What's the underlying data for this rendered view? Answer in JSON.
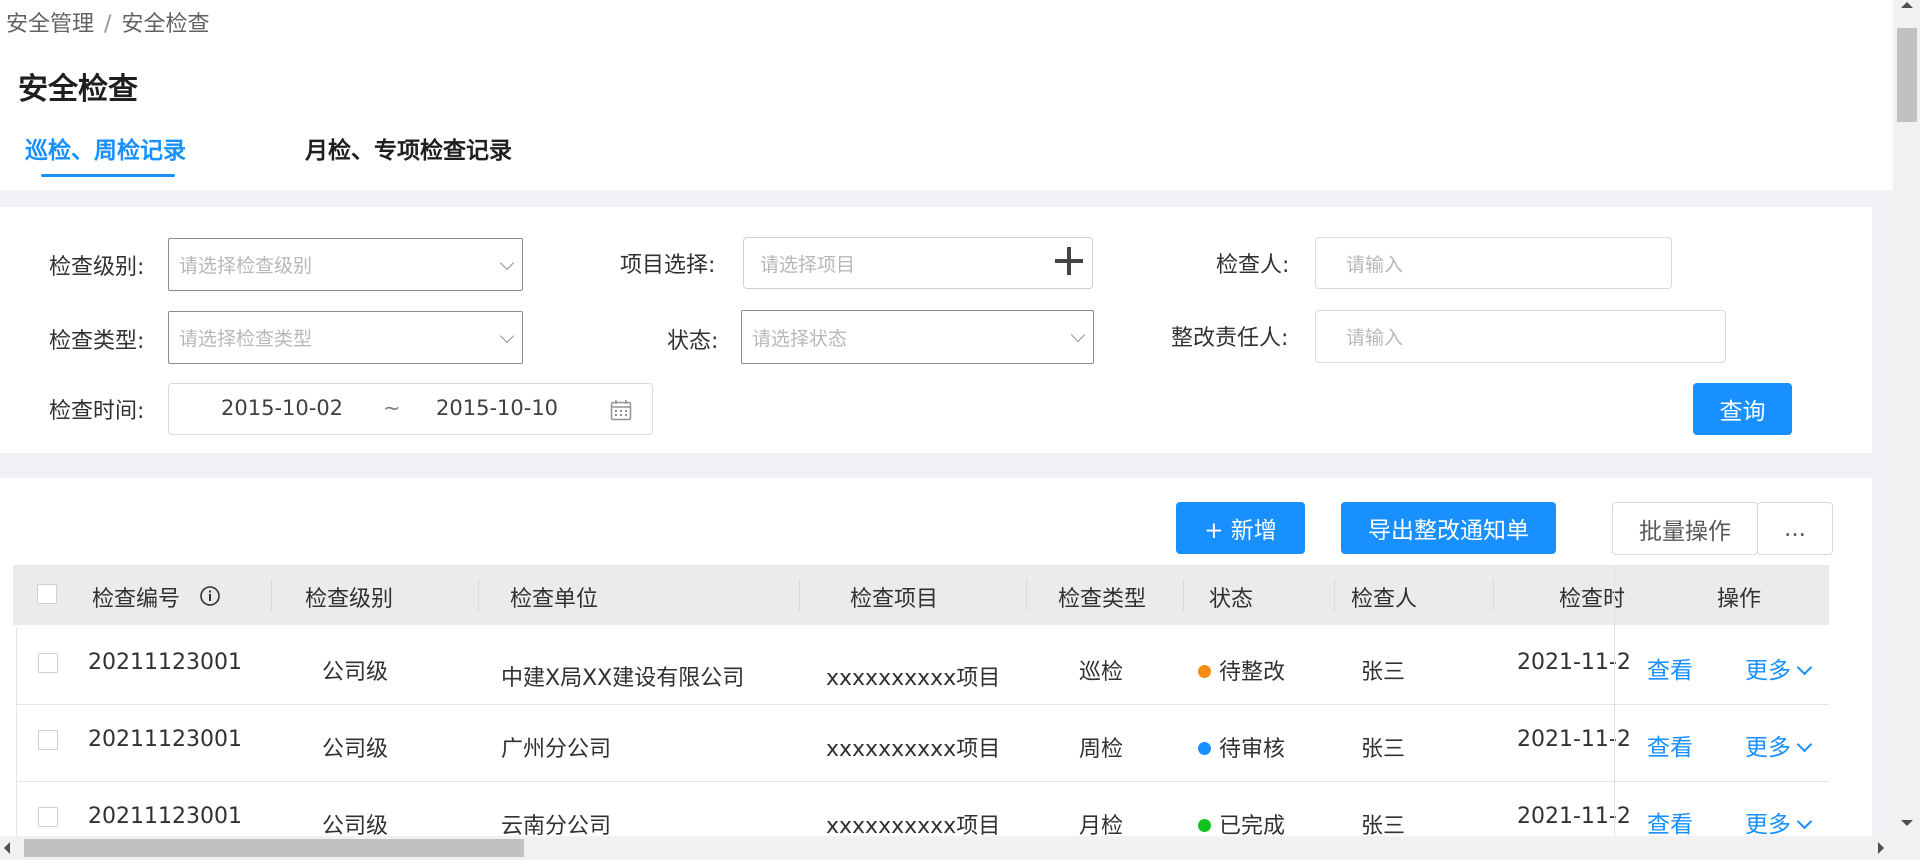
{
  "breadcrumb": {
    "root": "安全管理",
    "separator": "/",
    "current": "安全检查"
  },
  "page_title": "安全检查",
  "tabs": [
    {
      "label": "巡检、周检记录",
      "active": true
    },
    {
      "label": "月检、专项检查记录",
      "active": false
    }
  ],
  "filters": {
    "level": {
      "label": "检查级别:",
      "placeholder": "请选择检查级别"
    },
    "project": {
      "label": "项目选择:",
      "placeholder": "请选择项目"
    },
    "inspector": {
      "label": "检查人:",
      "placeholder": "请输入"
    },
    "type": {
      "label": "检查类型:",
      "placeholder": "请选择检查类型"
    },
    "status": {
      "label": "状态:",
      "placeholder": "请选择状态"
    },
    "responsible": {
      "label": "整改责任人:",
      "placeholder": "请输入"
    },
    "time": {
      "label": "检查时间:",
      "start": "2015-10-02",
      "separator": "~",
      "end": "2015-10-10"
    },
    "query_button": "查询"
  },
  "toolbar": {
    "add_button": "+  新增",
    "export_button": "导出整改通知单",
    "batch_button": "批量操作",
    "more_button": "..."
  },
  "table": {
    "columns": {
      "code": "检查编号",
      "level": "检查级别",
      "unit": "检查单位",
      "project": "检查项目",
      "type": "检查类型",
      "status": "状态",
      "inspector": "检查人",
      "time": "检查时",
      "actions": "操作"
    },
    "rows": [
      {
        "code": "20211123001",
        "level": "公司级",
        "unit": "中建X局XX建设有限公司",
        "project": "xxxxxxxxxx项目",
        "type": "巡检",
        "status": "待整改",
        "status_color": "#fa8c16",
        "inspector": "张三",
        "time": "2021-11-2",
        "view": "查看",
        "more": "更多"
      },
      {
        "code": "20211123001",
        "level": "公司级",
        "unit": "广州分公司",
        "project": "xxxxxxxxxx项目",
        "type": "周检",
        "status": "待审核",
        "status_color": "#1890ff",
        "inspector": "张三",
        "time": "2021-11-2",
        "view": "查看",
        "more": "更多"
      },
      {
        "code": "20211123001",
        "level": "公司级",
        "unit": "云南分公司",
        "project": "xxxxxxxxxx项目",
        "type": "月检",
        "status": "已完成",
        "status_color": "#13c21e",
        "inspector": "张三",
        "time": "2021-11-2",
        "view": "查看",
        "more": "更多"
      }
    ]
  },
  "colors": {
    "primary": "#1890ff",
    "background": "#f0f2f5"
  }
}
